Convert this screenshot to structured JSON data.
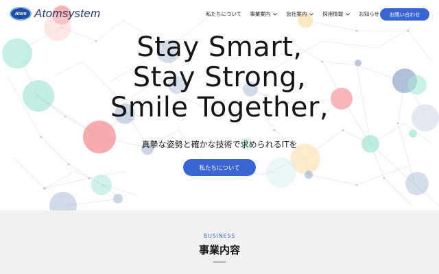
{
  "header": {
    "logo_mark": "Atom",
    "logo_text": "Atomsystem",
    "nav": [
      {
        "label": "私たちについて",
        "has_dropdown": false
      },
      {
        "label": "事業案内",
        "has_dropdown": true
      },
      {
        "label": "会社案内",
        "has_dropdown": true
      },
      {
        "label": "採用情報",
        "has_dropdown": true
      },
      {
        "label": "お知らせ",
        "has_dropdown": false
      }
    ],
    "contact_label": "お問い合わせ"
  },
  "hero": {
    "headline": [
      "Stay Smart,",
      "Stay Strong,",
      "Smile Together,"
    ],
    "subtitle": "真摯な姿勢と確かな技術で求められるITを",
    "button_label": "私たちについて"
  },
  "business": {
    "eyebrow": "BUSINESS",
    "title": "事業内容"
  },
  "colors": {
    "accent": "#3a66d4",
    "brand_navy": "#1c4fa3",
    "bubble_red": "#f7a5a8",
    "bubble_teal": "#a6e6d8",
    "bubble_blue": "#a9bbd6",
    "bubble_yellow": "#fbe3b8"
  }
}
